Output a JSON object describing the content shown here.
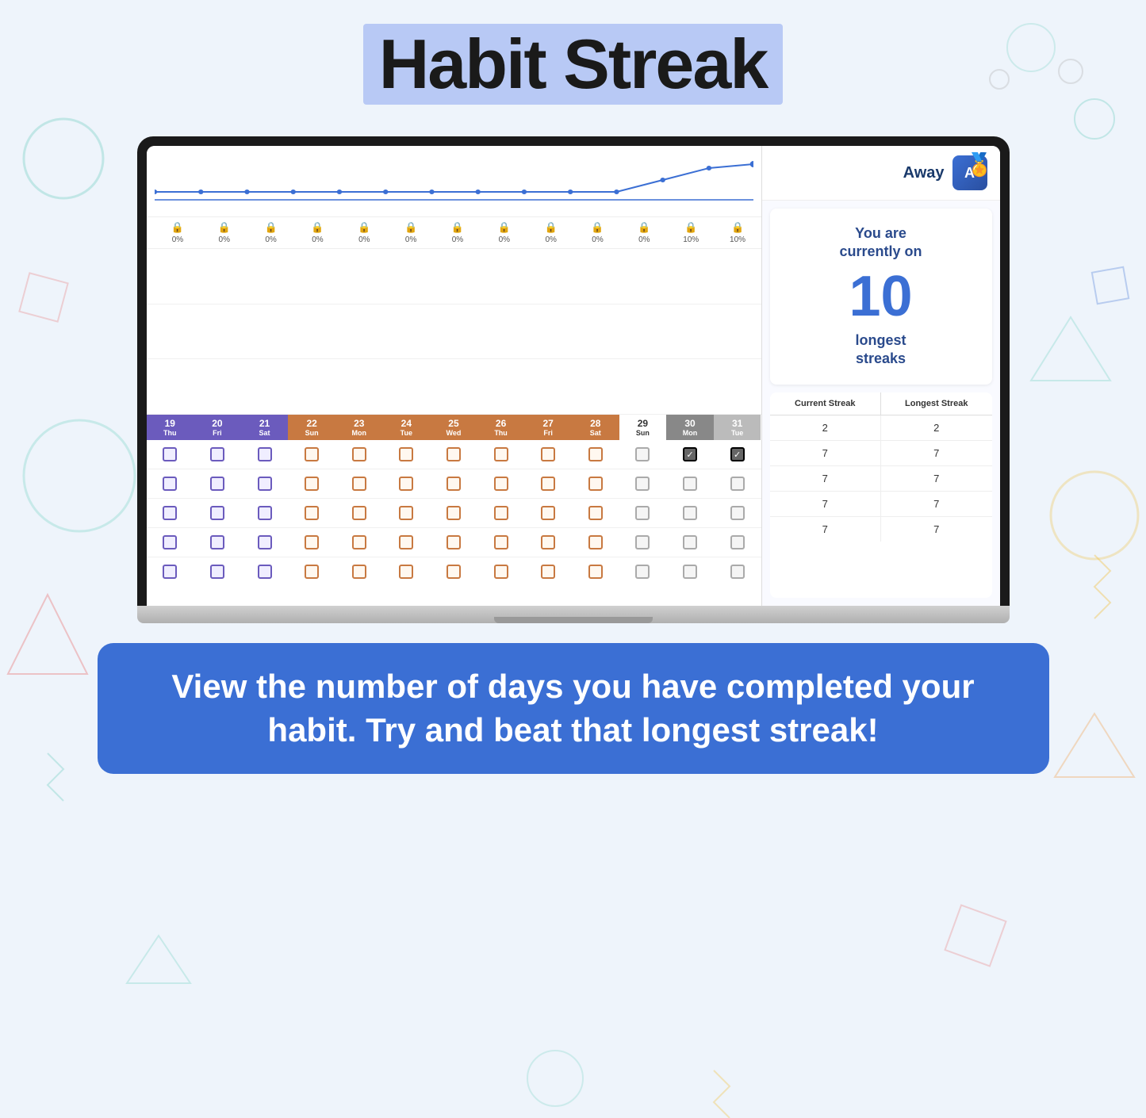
{
  "page": {
    "title": "Habit Streak",
    "background_color": "#eef4fb"
  },
  "header": {
    "title": "Habit Streak"
  },
  "laptop": {
    "away_label": "Away",
    "streak_card": {
      "line1": "You are",
      "line2": "currently on",
      "number": "10",
      "line3": "longest",
      "line4": "streaks"
    },
    "table": {
      "headers": [
        "Current Streak",
        "Longest Streak"
      ],
      "rows": [
        [
          "2",
          "2"
        ],
        [
          "7",
          "7"
        ],
        [
          "7",
          "7"
        ],
        [
          "7",
          "7"
        ],
        [
          "7",
          "7"
        ]
      ]
    },
    "dates": [
      {
        "num": "19",
        "day": "Thu",
        "style": "purple"
      },
      {
        "num": "20",
        "day": "Fri",
        "style": "purple"
      },
      {
        "num": "21",
        "day": "Sat",
        "style": "purple"
      },
      {
        "num": "22",
        "day": "Sun",
        "style": "orange"
      },
      {
        "num": "23",
        "day": "Mon",
        "style": "orange"
      },
      {
        "num": "24",
        "day": "Tue",
        "style": "orange"
      },
      {
        "num": "25",
        "day": "Wed",
        "style": "orange"
      },
      {
        "num": "26",
        "day": "Thu",
        "style": "orange"
      },
      {
        "num": "27",
        "day": "Fri",
        "style": "orange"
      },
      {
        "num": "28",
        "day": "Sat",
        "style": "orange"
      },
      {
        "num": "29",
        "day": "Sun",
        "style": "white"
      },
      {
        "num": "30",
        "day": "Mon",
        "style": "gray"
      },
      {
        "num": "31",
        "day": "Tue",
        "style": "light-gray"
      }
    ],
    "percentages": [
      "0%",
      "0%",
      "0%",
      "0%",
      "0%",
      "0%",
      "0%",
      "0%",
      "0%",
      "0%",
      "0%",
      "10%",
      "10%"
    ]
  },
  "banner": {
    "text": "View the number of days you have completed your habit. Try and beat that longest streak!"
  }
}
